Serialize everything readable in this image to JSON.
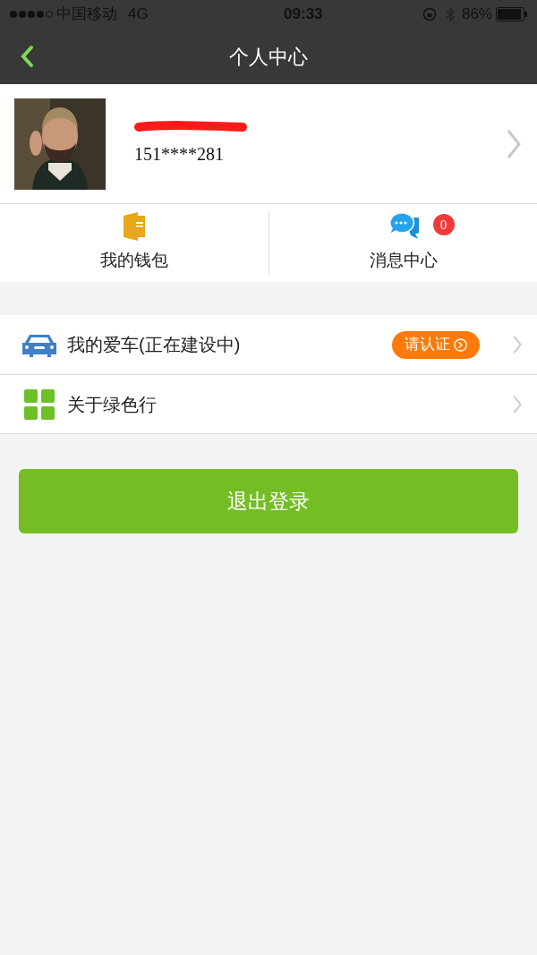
{
  "status_bar": {
    "carrier": "中国移动",
    "network": "4G",
    "time": "09:33",
    "battery": "86%"
  },
  "nav_bar": {
    "title": "个人中心"
  },
  "profile": {
    "phone": "151****281"
  },
  "shortcuts": [
    {
      "kind": "wallet",
      "label": "我的钱包"
    },
    {
      "kind": "messages",
      "label": "消息中心",
      "count": "0"
    }
  ],
  "menu": [
    {
      "kind": "car",
      "label": "我的爱车(正在建设中)",
      "badge": "请认证"
    },
    {
      "kind": "grid",
      "label": "关于绿色行"
    }
  ],
  "logout_button": "退出登录"
}
